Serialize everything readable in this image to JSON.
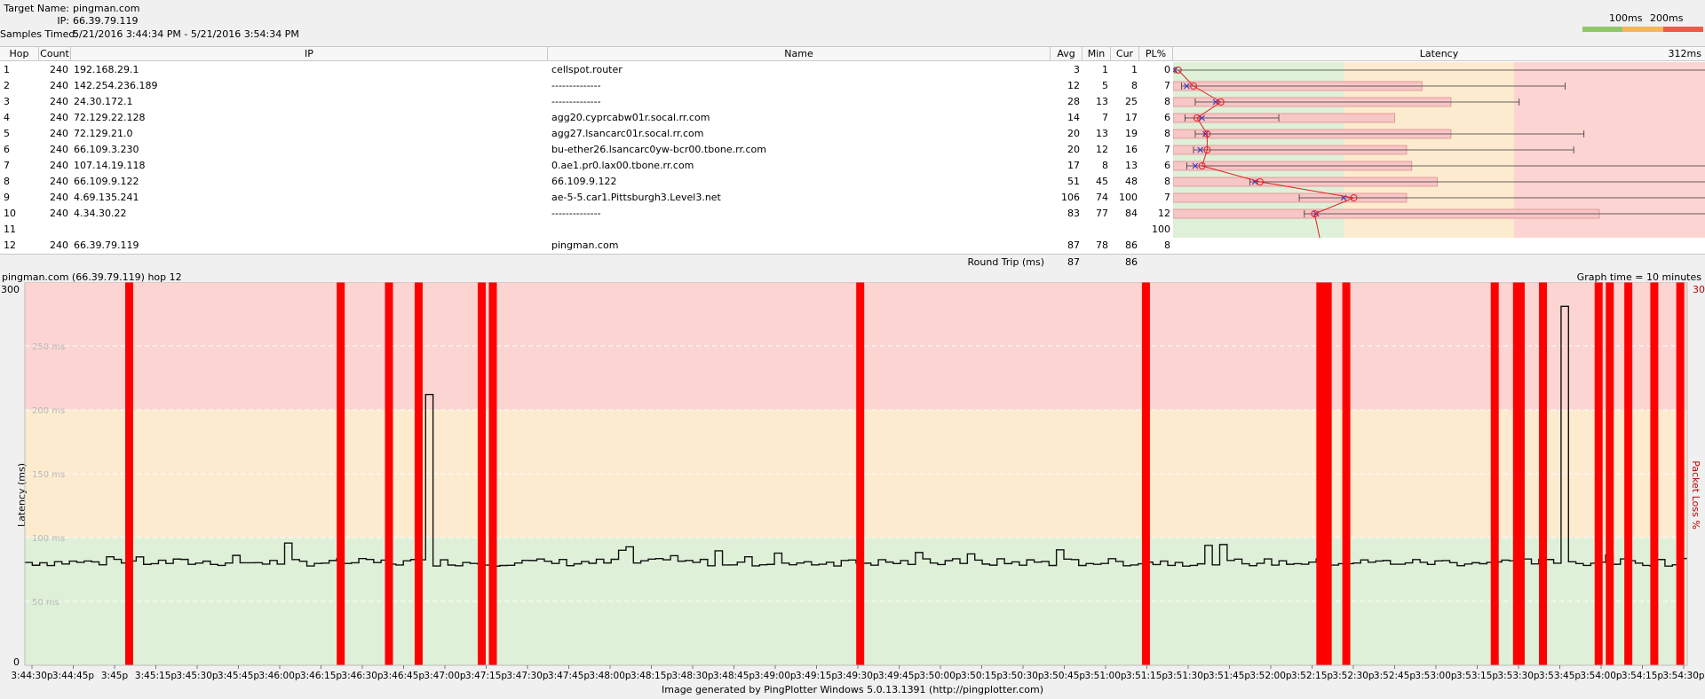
{
  "header": {
    "target_label": "Target Name:",
    "target_value": "pingman.com",
    "ip_label": "IP:",
    "ip_value": "66.39.79.119",
    "samples_label": "Samples Timed:",
    "samples_value": "5/21/2016 3:44:34 PM - 5/21/2016 3:54:34 PM",
    "legend_100": "100ms",
    "legend_200": "200ms"
  },
  "colors": {
    "good": "#8fc76a",
    "warn": "#f6b75a",
    "bad": "#ec5a48",
    "bg_good": "#dff0d8",
    "bg_warn": "#fdebd0",
    "bg_bad": "#fcd5d2",
    "loss": "#ff0000",
    "bar": "#f7c6c6"
  },
  "table": {
    "columns": {
      "hop": "Hop",
      "count": "Count",
      "ip": "IP",
      "name": "Name",
      "avg": "Avg",
      "min": "Min",
      "cur": "Cur",
      "pl": "PL%",
      "latency": "Latency",
      "latency_max": "312ms"
    },
    "rows": [
      {
        "hop": "1",
        "count": "240",
        "ip": "192.168.29.1",
        "name": "cellspot.router",
        "avg": "3",
        "min": "1",
        "cur": "1",
        "pl": "0"
      },
      {
        "hop": "2",
        "count": "240",
        "ip": "142.254.236.189",
        "name": " --------------",
        "avg": "12",
        "min": "5",
        "cur": "8",
        "pl": "7"
      },
      {
        "hop": "3",
        "count": "240",
        "ip": "24.30.172.1",
        "name": " --------------",
        "avg": "28",
        "min": "13",
        "cur": "25",
        "pl": "8"
      },
      {
        "hop": "4",
        "count": "240",
        "ip": "72.129.22.128",
        "name": "agg20.cyprcabw01r.socal.rr.com",
        "avg": "14",
        "min": "7",
        "cur": "17",
        "pl": "6"
      },
      {
        "hop": "5",
        "count": "240",
        "ip": "72.129.21.0",
        "name": "agg27.lsancarc01r.socal.rr.com",
        "avg": "20",
        "min": "13",
        "cur": "19",
        "pl": "8"
      },
      {
        "hop": "6",
        "count": "240",
        "ip": "66.109.3.230",
        "name": "bu-ether26.lsancarc0yw-bcr00.tbone.rr.com",
        "avg": "20",
        "min": "12",
        "cur": "16",
        "pl": "7"
      },
      {
        "hop": "7",
        "count": "240",
        "ip": "107.14.19.118",
        "name": "0.ae1.pr0.lax00.tbone.rr.com",
        "avg": "17",
        "min": "8",
        "cur": "13",
        "pl": "6"
      },
      {
        "hop": "8",
        "count": "240",
        "ip": "66.109.9.122",
        "name": "66.109.9.122",
        "avg": "51",
        "min": "45",
        "cur": "48",
        "pl": "8"
      },
      {
        "hop": "9",
        "count": "240",
        "ip": "4.69.135.241",
        "name": "ae-5-5.car1.Pittsburgh3.Level3.net",
        "avg": "106",
        "min": "74",
        "cur": "100",
        "pl": "7"
      },
      {
        "hop": "10",
        "count": "240",
        "ip": "4.34.30.22",
        "name": " --------------",
        "avg": "83",
        "min": "77",
        "cur": "84",
        "pl": "12"
      },
      {
        "hop": "11",
        "count": "",
        "ip": "",
        "name": "",
        "avg": "",
        "min": "",
        "cur": "",
        "pl": "100"
      },
      {
        "hop": "12",
        "count": "240",
        "ip": "66.39.79.119",
        "name": "pingman.com",
        "avg": "87",
        "min": "78",
        "cur": "86",
        "pl": "8"
      }
    ],
    "round_trip": {
      "label": "Round Trip (ms)",
      "avg": "87",
      "cur": "86"
    },
    "latency_bars": [
      {
        "min": 1,
        "avg": 3,
        "cur": 1,
        "max": 313,
        "has_bar": false
      },
      {
        "min": 5,
        "avg": 12,
        "cur": 8,
        "max": 230,
        "has_bar": true,
        "bar_max": 146
      },
      {
        "min": 13,
        "avg": 28,
        "cur": 25,
        "max": 203,
        "has_bar": true,
        "bar_max": 163
      },
      {
        "min": 7,
        "avg": 14,
        "cur": 17,
        "max": 62,
        "has_bar": true,
        "bar_max": 130
      },
      {
        "min": 13,
        "avg": 20,
        "cur": 19,
        "max": 241,
        "has_bar": true,
        "bar_max": 163
      },
      {
        "min": 12,
        "avg": 20,
        "cur": 16,
        "max": 235,
        "has_bar": true,
        "bar_max": 137
      },
      {
        "min": 8,
        "avg": 17,
        "cur": 13,
        "max": 322,
        "has_bar": true,
        "bar_max": 140
      },
      {
        "min": 45,
        "avg": 51,
        "cur": 48,
        "max": 392,
        "has_bar": true,
        "bar_max": 155
      },
      {
        "min": 74,
        "avg": 106,
        "cur": 100,
        "max": 553,
        "has_bar": true,
        "bar_max": 137
      },
      {
        "min": 77,
        "avg": 83,
        "cur": 84,
        "max": 425,
        "has_bar": true,
        "bar_max": 250
      },
      null,
      {
        "min": 78,
        "avg": 87,
        "cur": 86,
        "max": 593,
        "has_bar": true,
        "bar_max": 164
      }
    ]
  },
  "graph": {
    "title": "pingman.com (66.39.79.119) hop 12",
    "time_label": "Graph time = 10 minutes",
    "y_axis_label": "Latency (ms)",
    "y2_axis_label": "Packet Loss %",
    "y_top": "300",
    "y_bottom": "0",
    "y2_top": "30",
    "y_ticks": [
      "250 ms",
      "200 ms",
      "150 ms",
      "100 ms",
      "50 ms"
    ],
    "x_labels": [
      "3:44:30p",
      "3:44:45p",
      "3:45p",
      "3:45:15p",
      "3:45:30p",
      "3:45:45p",
      "3:46:00p",
      "3:46:15p",
      "3:46:30p",
      "3:46:45p",
      "3:47:00p",
      "3:47:15p",
      "3:47:30p",
      "3:47:45p",
      "3:48:00p",
      "3:48:15p",
      "3:48:30p",
      "3:48:45p",
      "3:49:00p",
      "3:49:15p",
      "3:49:30p",
      "3:49:45p",
      "3:50:00p",
      "3:50:15p",
      "3:50:30p",
      "3:50:45p",
      "3:51:00p",
      "3:51:15p",
      "3:51:30p",
      "3:51:45p",
      "3:52:00p",
      "3:52:15p",
      "3:52:30p",
      "3:52:45p",
      "3:53:00p",
      "3:53:15p",
      "3:53:30p",
      "3:53:45p",
      "3:54:00p",
      "3:54:15p",
      "3:54:30p"
    ],
    "loss_seconds": [
      28,
      85,
      98,
      106,
      123,
      126,
      225,
      302,
      349,
      350,
      351,
      356,
      396,
      402,
      403,
      409,
      424,
      427,
      432,
      439,
      446
    ],
    "spikes": [
      {
        "t": 108,
        "ms": 212
      },
      {
        "t": 414,
        "ms": 281
      }
    ],
    "baseline_ms": 80
  },
  "footer": "Image generated by PingPlotter Windows 5.0.13.1391 (http://pingplotter.com)"
}
